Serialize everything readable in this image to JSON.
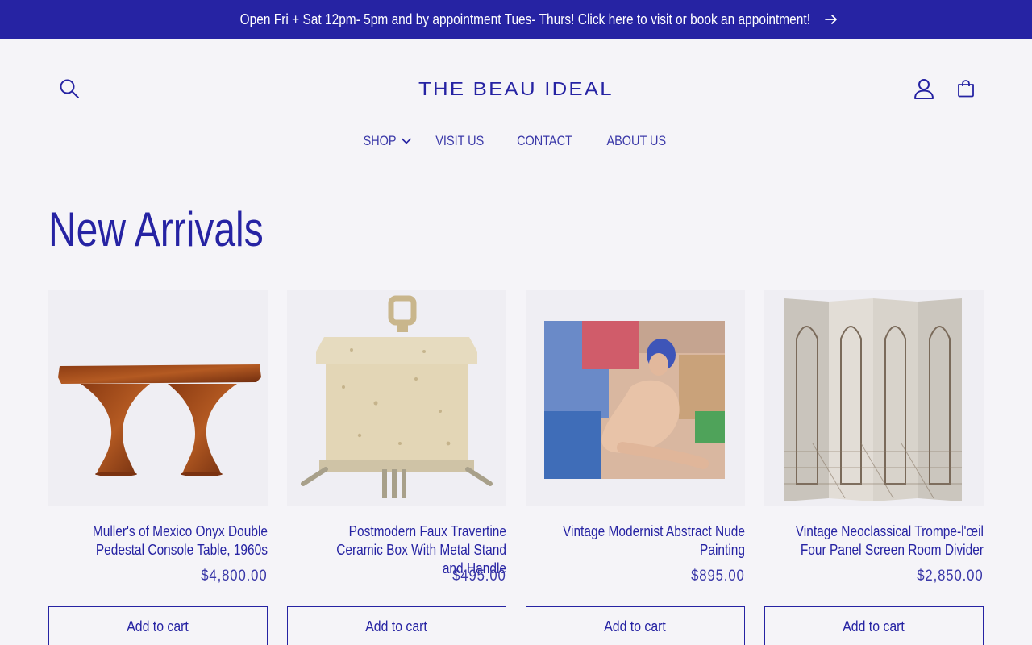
{
  "announcement": {
    "text": "Open Fri + Sat 12pm- 5pm and by appointment Tues- Thurs! Click here to visit or book an appointment!",
    "icon": "arrow-right-icon"
  },
  "header": {
    "logo_text": "THE BEAU IDEAL",
    "icons": [
      "search-icon",
      "account-icon",
      "cart-icon"
    ]
  },
  "nav": {
    "items": [
      {
        "label": "SHOP",
        "has_dropdown": true
      },
      {
        "label": "VISIT US"
      },
      {
        "label": "CONTACT"
      },
      {
        "label": "ABOUT US"
      }
    ]
  },
  "section": {
    "title": "New Arrivals"
  },
  "products": [
    {
      "title": "Muller's of Mexico Onyx Double Pedestal Console Table, 1960s",
      "price": "$4,800.00",
      "button": "Add to cart"
    },
    {
      "title": "Postmodern Faux Travertine Ceramic Box With Metal Stand and Handle",
      "price": "$495.00",
      "button": "Add to cart"
    },
    {
      "title": "Vintage Modernist Abstract Nude Painting",
      "price": "$895.00",
      "button": "Add to cart"
    },
    {
      "title": "Vintage Neoclassical Trompe-l'œil Four Panel Screen Room Divider",
      "price": "$2,850.00",
      "button": "Add to cart"
    }
  ],
  "colors": {
    "brand": "#2623a3",
    "background": "#f5f4f8",
    "announcement_text": "#ffffff"
  }
}
